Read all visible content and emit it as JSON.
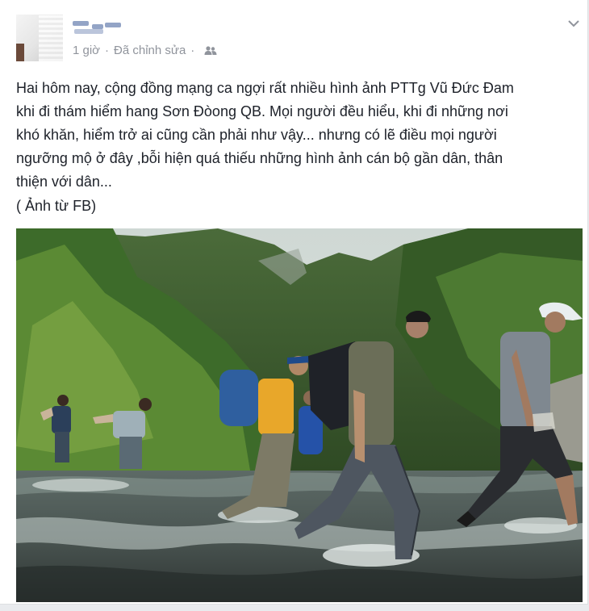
{
  "post": {
    "author_name": "",
    "timestamp": "1 giờ",
    "edited_label": "Đã chỉnh sửa",
    "separator": "·",
    "audience_icon": "friends-icon",
    "options_icon": "chevron-down-icon",
    "text": "Hai hôm nay, cộng đồng mạng ca ngợi rất nhiều hình ảnh PTTg Vũ Đức Đam\nkhi đi thám hiểm hang Sơn Đòong QB. Mọi người đều hiểu, khi đi những nơi\nkhó khăn, hiểm trở ai cũng cần phải như vậy... nhưng có lẽ điều mọi người\nngưỡng mộ ở đây ,bỗi hiện quá thiếu những hình ảnh cán bộ gần dân, thân\nthiện với dân...",
    "caption": "( Ảnh từ FB)"
  },
  "colors": {
    "meta_text": "#90949c",
    "body_text": "#1d2129",
    "link": "#3b5998"
  }
}
